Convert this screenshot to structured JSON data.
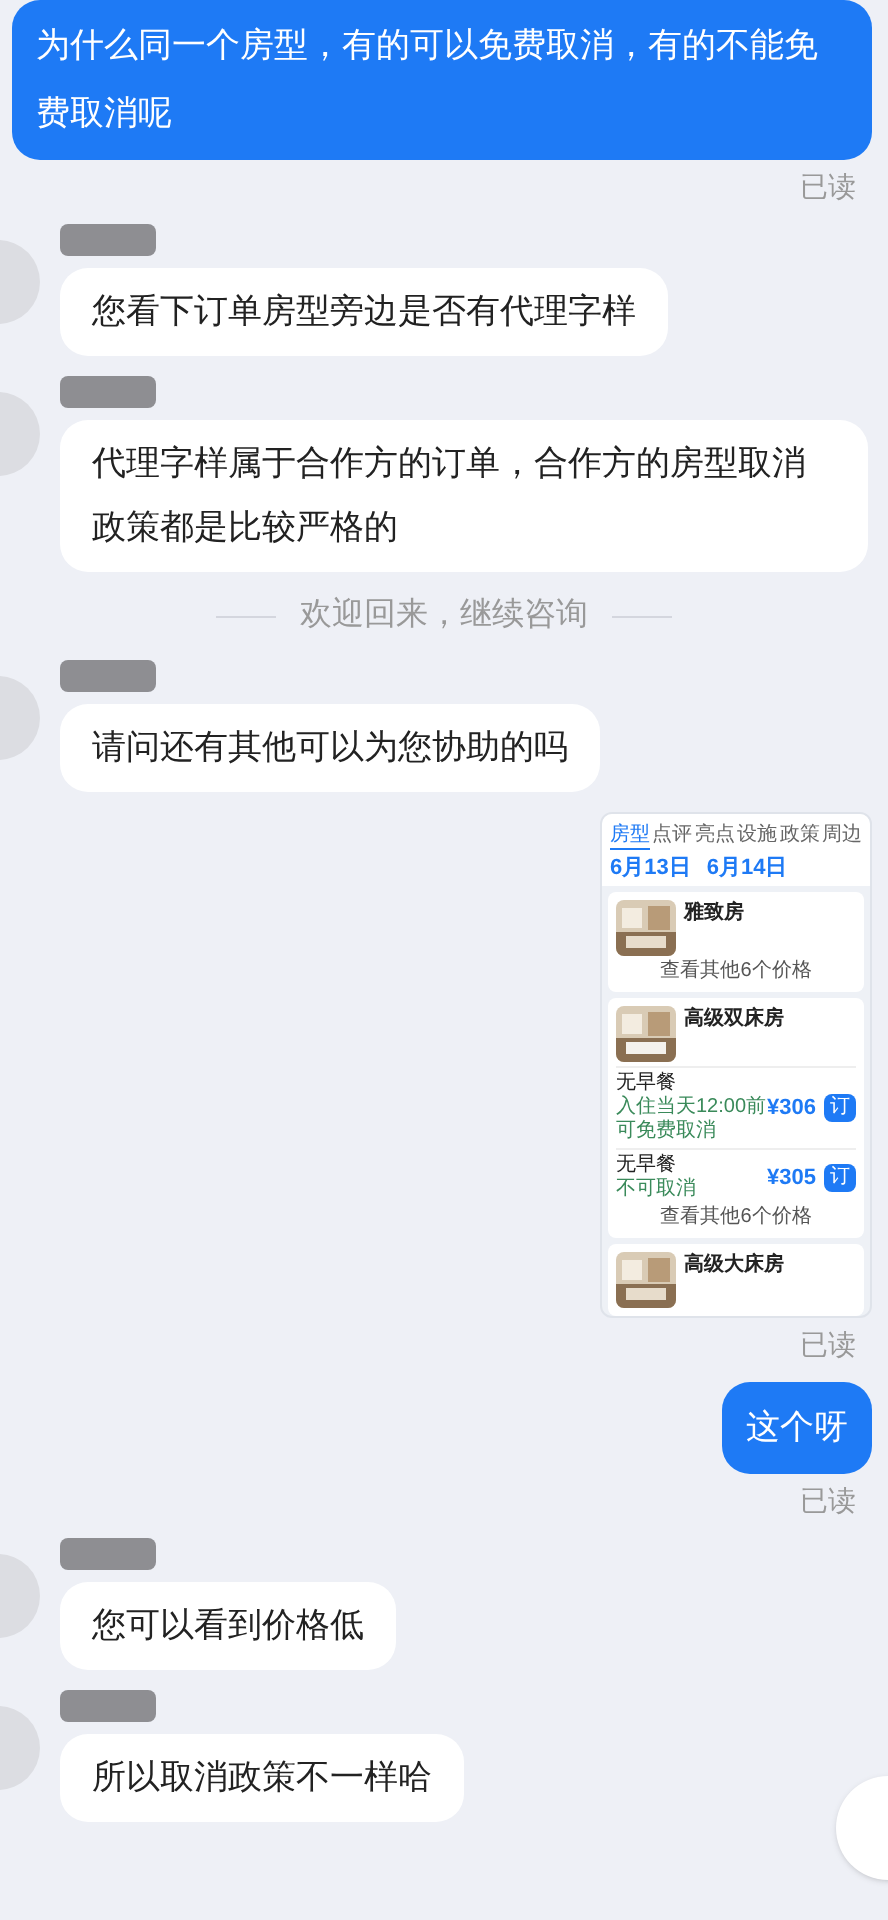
{
  "messages": [
    {
      "kind": "outgoing_text",
      "text": "为什么同一个房型，有的可以免费取消，有的不能免费取消呢",
      "status": "已读"
    },
    {
      "kind": "incoming_text",
      "text": "您看下订单房型旁边是否有代理字样"
    },
    {
      "kind": "incoming_text",
      "text": "代理字样属于合作方的订单，合作方的房型取消政策都是比较严格的"
    },
    {
      "kind": "system",
      "text": "欢迎回来，继续咨询"
    },
    {
      "kind": "incoming_text",
      "text": "请问还有其他可以为您协助的吗"
    },
    {
      "kind": "outgoing_image",
      "status": "已读",
      "screenshot": {
        "tabs": [
          {
            "label": "房型",
            "selected": true
          },
          {
            "label": "点评",
            "selected": false
          },
          {
            "label": "亮点",
            "selected": false
          },
          {
            "label": "设施",
            "selected": false
          },
          {
            "label": "政策",
            "selected": false
          },
          {
            "label": "周边",
            "selected": false
          }
        ],
        "dates": [
          "6月13日",
          "6月14日"
        ],
        "rooms": [
          {
            "name": "雅致房",
            "more": "查看其他6个价格"
          },
          {
            "name": "高级双床房",
            "offers": [
              {
                "meal": "无早餐",
                "cancel": "入住当天12:00前可免费取消",
                "price": "¥306",
                "book": "订"
              },
              {
                "meal": "无早餐",
                "cancel": "不可取消",
                "price": "¥305",
                "book": "订"
              }
            ],
            "more": "查看其他6个价格"
          },
          {
            "name": "高级大床房"
          }
        ]
      }
    },
    {
      "kind": "outgoing_text",
      "text": "这个呀",
      "status": "已读"
    },
    {
      "kind": "incoming_text",
      "text": "您可以看到价格低"
    },
    {
      "kind": "incoming_text",
      "text": "所以取消政策不一样哈"
    }
  ]
}
